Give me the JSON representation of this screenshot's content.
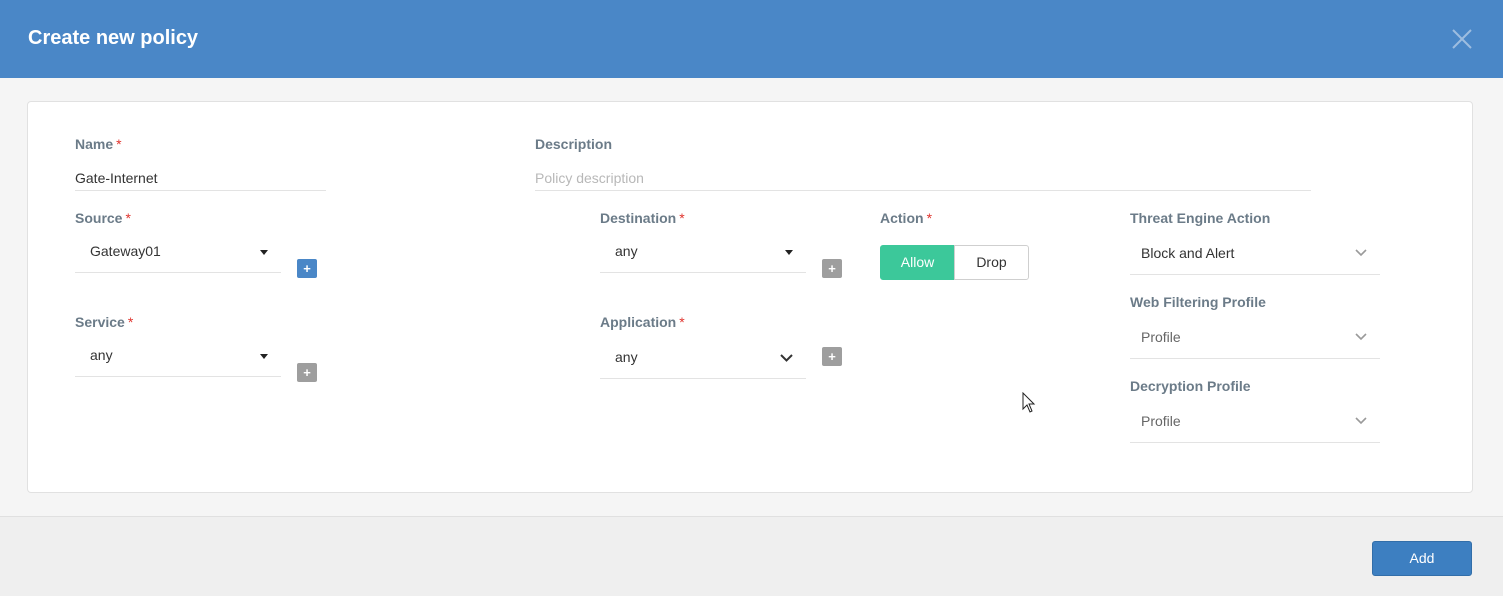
{
  "dialog": {
    "title": "Create new policy",
    "close_icon": "close-icon",
    "header_color": "#4a87c7"
  },
  "form": {
    "required_marker": "*",
    "name": {
      "label": "Name",
      "value": "Gate-Internet"
    },
    "description": {
      "label": "Description",
      "value": "",
      "placeholder": "Policy description"
    },
    "source": {
      "label": "Source",
      "value": "Gateway01"
    },
    "destination": {
      "label": "Destination",
      "value": "any"
    },
    "service": {
      "label": "Service",
      "value": "any"
    },
    "application": {
      "label": "Application",
      "value": "any"
    },
    "action": {
      "label": "Action",
      "options": [
        "Allow",
        "Drop"
      ],
      "selected": "Allow",
      "selected_color": "#3cc89a"
    },
    "threat_engine_action": {
      "label": "Threat Engine Action",
      "value": "Block and Alert"
    },
    "web_filtering_profile": {
      "label": "Web Filtering Profile",
      "value": "Profile"
    },
    "decryption_profile": {
      "label": "Decryption Profile",
      "value": "Profile"
    },
    "add_more_symbol": "+"
  },
  "footer": {
    "add_label": "Add",
    "add_color": "#3d7fc1"
  }
}
